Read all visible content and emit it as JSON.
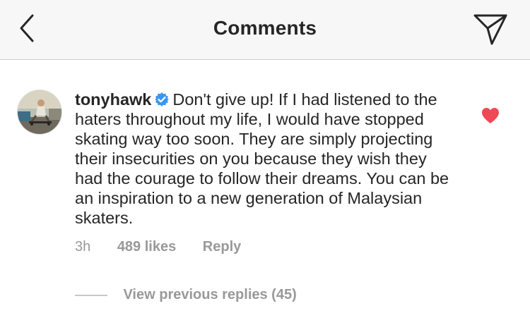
{
  "header": {
    "title": "Comments",
    "back_icon": "chevron-left-icon",
    "share_icon": "paper-plane-icon"
  },
  "comment": {
    "username": "tonyhawk",
    "verified_icon": "verified-badge-icon",
    "text": "Don't give up! If I had listened to the haters throughout my life, I would have stopped skating way too soon. They are simply projecting their insecurities on you because they wish they had the courage to follow their dreams. You can be an inspiration to a new generation of Malaysian skaters.",
    "time": "3h",
    "likes": "489 likes",
    "reply_label": "Reply",
    "liked": true,
    "heart_color": "#ed4956",
    "verified_color": "#3897f0"
  },
  "replies": {
    "view_label": "View previous replies (45)"
  }
}
